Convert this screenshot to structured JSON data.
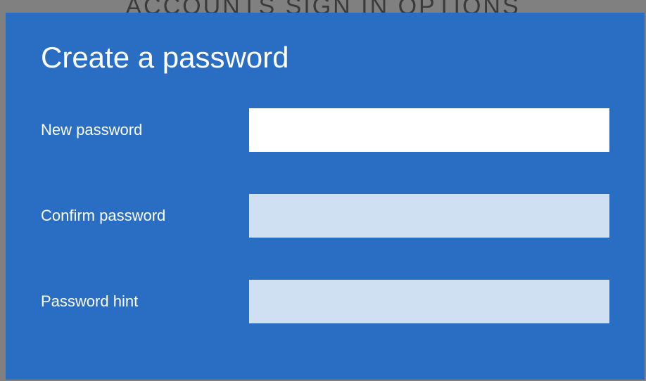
{
  "background": {
    "partial_text": "ACCOUNTS   SIGN IN OPTIONS"
  },
  "dialog": {
    "title": "Create a password",
    "fields": {
      "new_password": {
        "label": "New password",
        "value": "",
        "placeholder": ""
      },
      "confirm_password": {
        "label": "Confirm password",
        "value": "",
        "placeholder": ""
      },
      "password_hint": {
        "label": "Password hint",
        "value": "",
        "placeholder": ""
      }
    }
  },
  "colors": {
    "dialog_background": "#2a6ec4",
    "active_input_background": "#ffffff",
    "inactive_input_background": "#cfe0f2",
    "text_color": "#ffffff"
  }
}
